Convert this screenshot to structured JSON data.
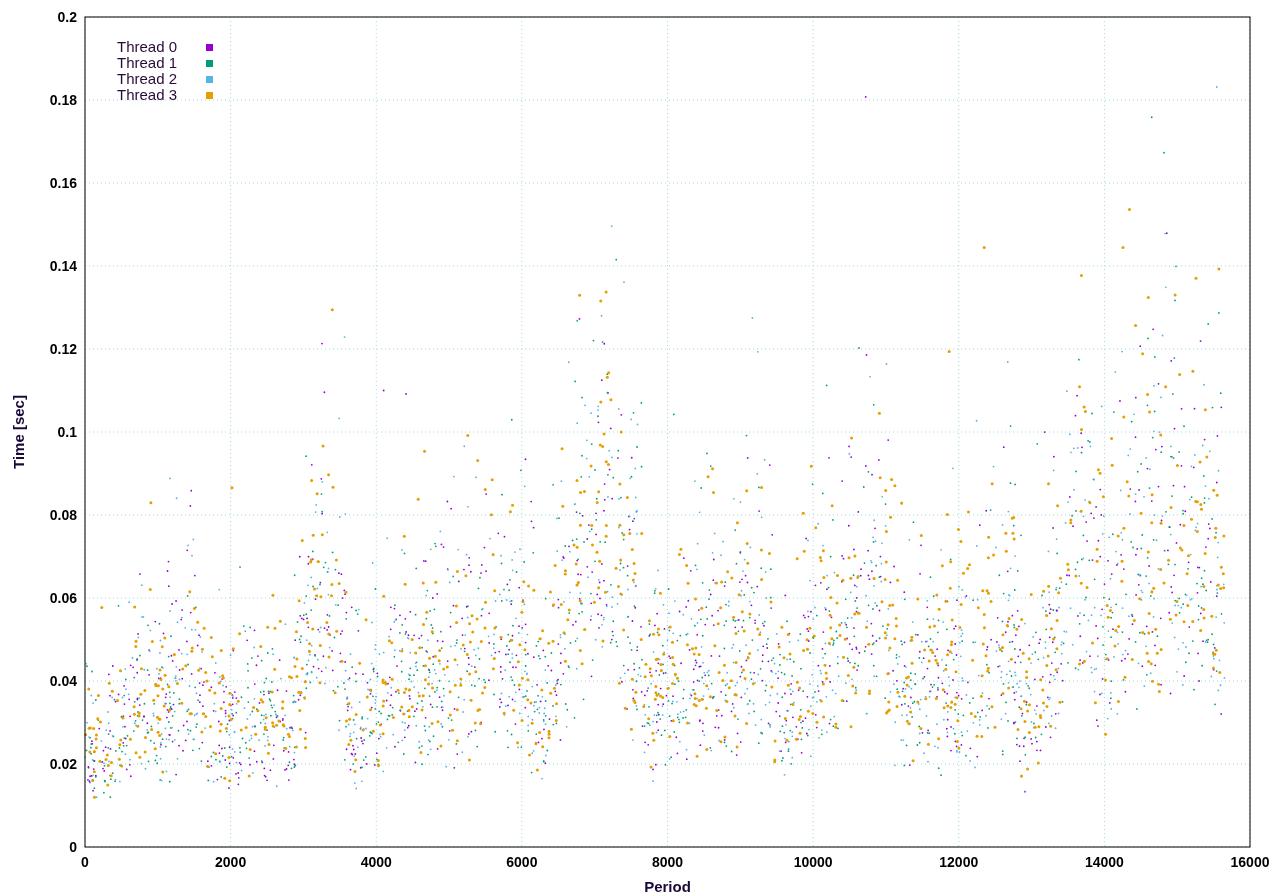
{
  "plot": {
    "grid": true,
    "x_axis": {
      "title": "Period",
      "ticks": [
        "0",
        "2000",
        "4000",
        "6000",
        "8000",
        "10000",
        "12000",
        "14000",
        "16000"
      ]
    },
    "y_axis": {
      "title": "Time [sec]",
      "ticks": [
        "0.2",
        "0.18",
        "0.16",
        "0.14",
        "0.12",
        "0.1",
        "0.08",
        "0.06",
        "0.04",
        "0.02",
        "0"
      ]
    },
    "legend": [
      {
        "label": "Thread 0",
        "color": "#9400d3"
      },
      {
        "label": "Thread 1",
        "color": "#009e73"
      },
      {
        "label": "Thread 2",
        "color": "#56b4e9"
      },
      {
        "label": "Thread 3",
        "color": "#e69f00"
      }
    ]
  }
}
